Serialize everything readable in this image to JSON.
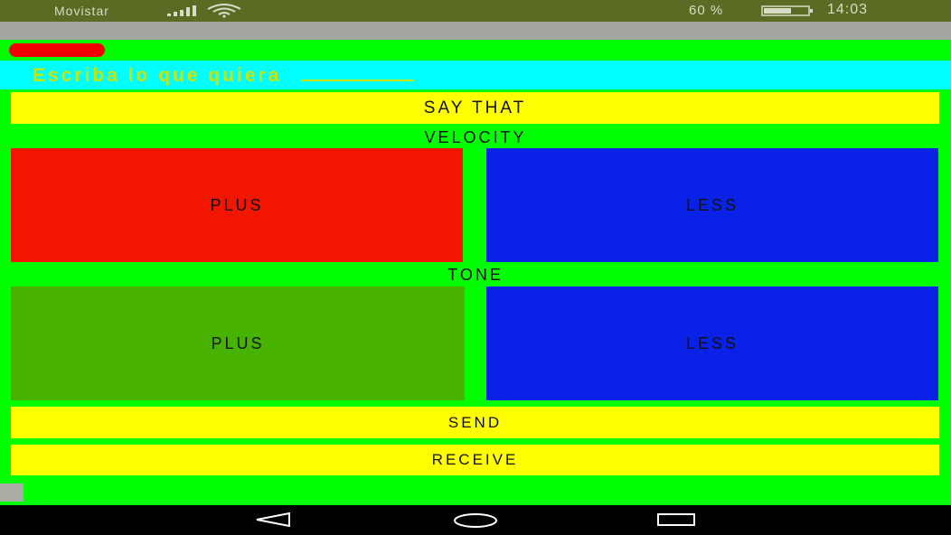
{
  "status_bar": {
    "carrier": "Movistar",
    "battery_percent": "60 %",
    "time": "14:03",
    "icons": [
      "signal-icon",
      "wifi-icon",
      "battery-icon"
    ]
  },
  "input": {
    "placeholder": "Escriba lo que quiera",
    "value": ""
  },
  "buttons": {
    "say_that": "SAY THAT",
    "send": "SEND",
    "receive": "RECEIVE"
  },
  "velocity": {
    "label": "VELOCITY",
    "plus": "PLUS",
    "less": "LESS"
  },
  "tone": {
    "label": "TONE",
    "plus": "PLUS",
    "less": "LESS"
  },
  "navigation": {
    "icons": [
      "back-icon",
      "home-icon",
      "recents-icon"
    ]
  },
  "colors": {
    "background": "#00ff00",
    "input_bg": "#00ffff",
    "yellow_buttons": "#ffff00",
    "velocity_plus": "#f21500",
    "less_buttons": "#0a22e8",
    "tone_plus": "#47b300"
  }
}
